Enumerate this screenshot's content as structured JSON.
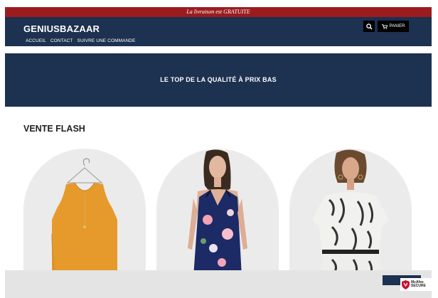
{
  "announcement": "La livraison est GRATUITE",
  "header": {
    "logo": "GENIUSBAZAAR",
    "nav": [
      "ACCUEIL",
      "CONTACT",
      "SUIVRE UNE COMMANDE"
    ],
    "cart_label": "PANIER"
  },
  "hero": {
    "text": "LE TOP DE LA QUALITÉ À PRIX BAS"
  },
  "section": {
    "title": "VENTE FLASH"
  },
  "badge": {
    "line1": "McAfee",
    "line2": "SECURE"
  },
  "colors": {
    "brand_navy": "#1d3150",
    "announcement_red": "#9b1c1f"
  },
  "icons": {
    "search": "search-icon",
    "cart": "cart-icon",
    "shield": "mcafee-shield-icon"
  }
}
